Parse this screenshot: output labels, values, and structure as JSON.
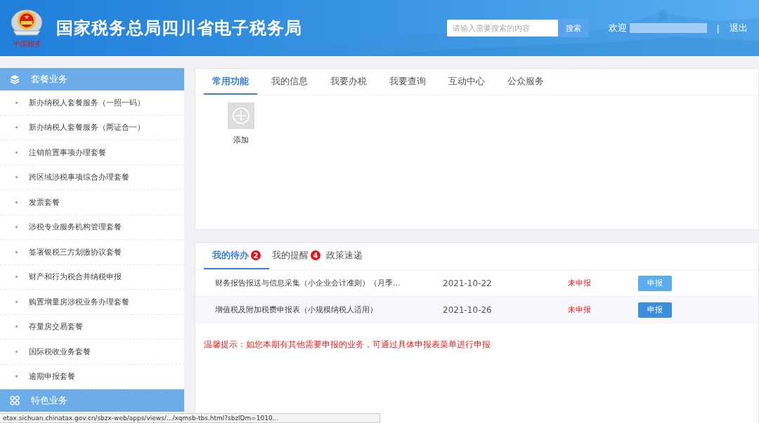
{
  "header": {
    "title": "国家税务总局四川省电子税务局",
    "logo_text": "中国税务",
    "search": {
      "placeholder": "请输入需要搜索的内容",
      "button": "搜索"
    },
    "welcome": "欢迎",
    "separator": "|",
    "logout": "退出"
  },
  "sidebar": {
    "sections": [
      {
        "title": "套餐业务",
        "items": [
          "新办纳税人套餐服务（一照一码）",
          "新办纳税人套餐服务（两证合一）",
          "注销前置事项办理套餐",
          "跨区域涉税事项综合办理套餐",
          "发票套餐",
          "涉税专业服务机构管理套餐",
          "签署银税三方划缴协议套餐",
          "财产和行为税合并纳税申报",
          "购置增量房涉税业务办理套餐",
          "存量房交易套餐",
          "国际税收业务套餐",
          "逾期申报套餐"
        ]
      },
      {
        "title": "特色业务"
      }
    ]
  },
  "main_tabs": [
    {
      "label": "常用功能",
      "selected": true
    },
    {
      "label": "我的信息",
      "selected": false
    },
    {
      "label": "我要办税",
      "selected": false
    },
    {
      "label": "我要查询",
      "selected": false
    },
    {
      "label": "互动中心",
      "selected": false
    },
    {
      "label": "公众服务",
      "selected": false
    }
  ],
  "shortcuts": [
    {
      "label": "添加"
    }
  ],
  "todo_tabs": [
    {
      "label": "我的待办",
      "badge": "2",
      "selected": true
    },
    {
      "label": "我的提醒",
      "badge": "4",
      "selected": false
    },
    {
      "label": "政策速递",
      "selected": false
    }
  ],
  "todo_rows": [
    {
      "name": "财务报告报送与信息采集（小企业会计准则）（月季...",
      "date": "2021-10-22",
      "status": "未申报",
      "action": "申报",
      "highlighted": false
    },
    {
      "name": "增值税及附加税费申报表（小规模纳税人适用）",
      "date": "2021-10-26",
      "status": "未申报",
      "action": "申报",
      "highlighted": true
    }
  ],
  "notice": "温馨提示：如您本期有其他需要申报的业务，可通过具体申报表菜单进行申报",
  "status_bar": "etax.sichuan.chinatax.gov.cn/sbzx-web/apps/views/.../xqmsb-tbs.html?sbzlDm=1010..."
}
